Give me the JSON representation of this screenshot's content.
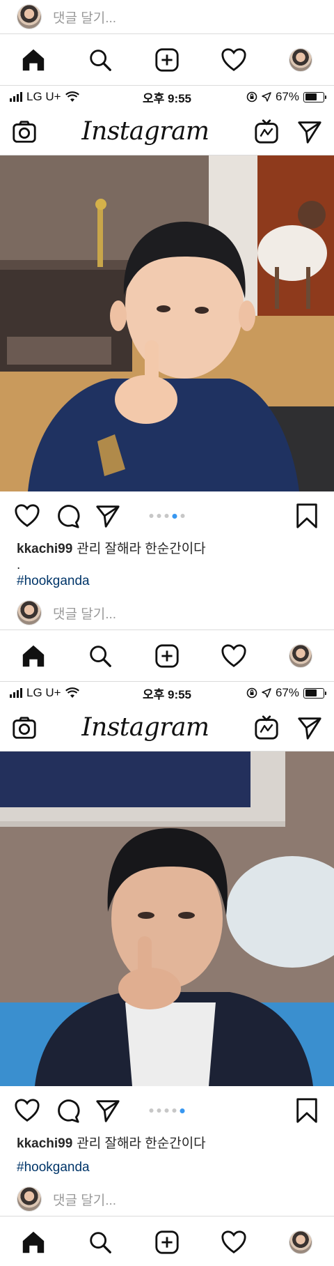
{
  "comment_placeholder": "댓글 달기...",
  "status": {
    "carrier": "LG U+",
    "time": "오후 9:55",
    "battery": "67%",
    "battery_level": 0.67
  },
  "app_logo": "Instagram",
  "nav_icons": [
    "home-icon",
    "search-icon",
    "new-post-icon",
    "activity-heart-icon",
    "profile-avatar"
  ],
  "header_icons": [
    "camera-icon",
    "igtv-icon",
    "direct-send-icon"
  ],
  "action_icons": [
    "like-heart-icon",
    "comment-icon",
    "share-icon",
    "bookmark-icon"
  ],
  "posts": [
    {
      "username": "kkachi99",
      "caption": "관리 잘해라 한순간이다",
      "dot_line": ".",
      "hashtag": "#hookganda",
      "carousel_dots": 5,
      "active_dot": 4
    },
    {
      "username": "kkachi99",
      "caption": "관리 잘해라 한순간이다",
      "hashtag": "#hookganda",
      "carousel_dots": 5,
      "active_dot": 5
    }
  ],
  "colors": {
    "link": "#003569",
    "dot_active": "#3897f0",
    "divider": "#dbdbdb"
  }
}
